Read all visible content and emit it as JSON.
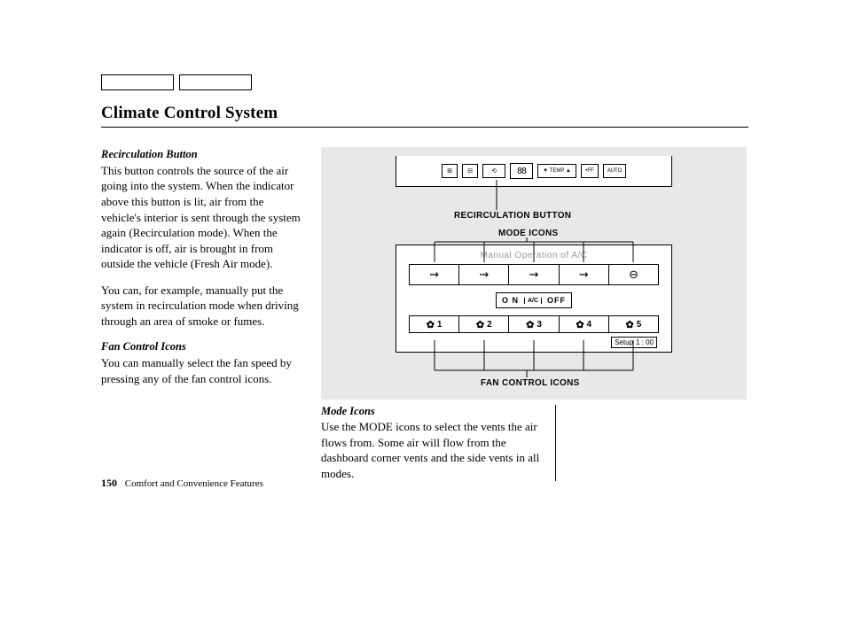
{
  "title": "Climate Control System",
  "sections": {
    "recirc": {
      "heading": "Recirculation Button",
      "body1": "This button controls the source of the air going into the system. When the indicator above this button is lit, air from the vehicle's interior is sent through the system again (Recircula­tion mode). When the indicator is off, air is brought in from outside the vehicle (Fresh Air mode).",
      "body2": "You can, for example, manually put the system in recirculation mode when driving through an area of smoke or fumes."
    },
    "fan": {
      "heading": "Fan Control Icons",
      "body": "You can manually select the fan speed by pressing any of the fan control icons."
    },
    "mode": {
      "heading": "Mode Icons",
      "body": "Use the MODE icons to select the vents the air flows from. Some air will flow from the dashboard corner vents and the side vents in all modes."
    }
  },
  "figure": {
    "labels": {
      "recirc": "RECIRCULATION BUTTON",
      "mode": "MODE ICONS",
      "fan": "FAN CONTROL ICONS"
    },
    "top_display": "88",
    "top_temp": "▼ TEMP ▲",
    "top_off": "•FF",
    "top_auto": "AUTO",
    "panel_title": "Manual Operation of A/C",
    "ac": {
      "on": "O N",
      "label": "A/C",
      "off": "OFF"
    },
    "fan_levels": [
      "1",
      "2",
      "3",
      "4",
      "5"
    ],
    "time": {
      "setup": "Setup",
      "value": "1 : 00"
    }
  },
  "footer": {
    "page": "150",
    "chapter": "Comfort and Convenience Features"
  }
}
